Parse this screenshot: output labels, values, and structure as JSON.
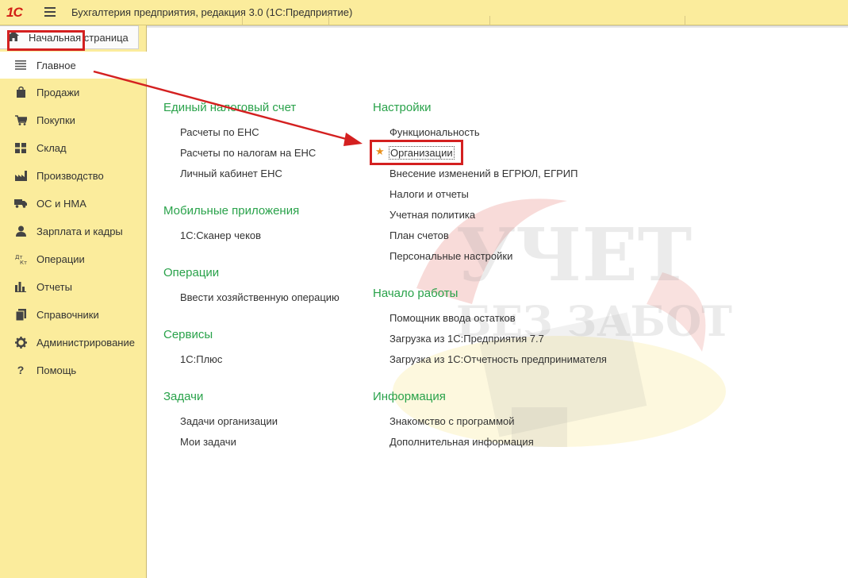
{
  "titlebar": {
    "logo": "1С",
    "app_title": "Бухгалтерия предприятия, редакция 3.0  (1С:Предприятие)"
  },
  "sidebar": {
    "home_label": "Начальная страница",
    "items": [
      {
        "label": "Главное",
        "icon": "menu-lines-icon",
        "active": true
      },
      {
        "label": "Продажи",
        "icon": "shopping-bag-icon"
      },
      {
        "label": "Покупки",
        "icon": "cart-icon"
      },
      {
        "label": "Склад",
        "icon": "warehouse-grid-icon"
      },
      {
        "label": "Производство",
        "icon": "factory-icon"
      },
      {
        "label": "ОС и НМА",
        "icon": "truck-icon"
      },
      {
        "label": "Зарплата и кадры",
        "icon": "person-icon"
      },
      {
        "label": "Операции",
        "icon": "debit-credit-icon"
      },
      {
        "label": "Отчеты",
        "icon": "bar-chart-icon"
      },
      {
        "label": "Справочники",
        "icon": "books-icon"
      },
      {
        "label": "Администрирование",
        "icon": "gear-icon"
      },
      {
        "label": "Помощь",
        "icon": "question-icon"
      }
    ]
  },
  "main": {
    "left_column": [
      {
        "title": "Единый налоговый счет",
        "links": [
          "Расчеты по ЕНС",
          "Расчеты по налогам на ЕНС",
          "Личный кабинет ЕНС"
        ]
      },
      {
        "title": "Мобильные приложения",
        "links": [
          "1С:Сканер чеков"
        ]
      },
      {
        "title": "Операции",
        "links": [
          "Ввести хозяйственную операцию"
        ]
      },
      {
        "title": "Сервисы",
        "links": [
          "1С:Плюс"
        ]
      },
      {
        "title": "Задачи",
        "links": [
          "Задачи организации",
          "Мои задачи"
        ]
      }
    ],
    "right_column": [
      {
        "title": "Настройки",
        "links": [
          "Функциональность",
          "Организации",
          "Внесение изменений в ЕГРЮЛ, ЕГРИП",
          "Налоги и отчеты",
          "Учетная политика",
          "План счетов",
          "Персональные настройки"
        ]
      },
      {
        "title": "Начало работы",
        "links": [
          "Помощник ввода остатков",
          "Загрузка из 1С:Предприятия 7.7",
          "Загрузка из 1С:Отчетность предпринимателя"
        ]
      },
      {
        "title": "Информация",
        "links": [
          "Знакомство с программой",
          "Дополнительная информация"
        ]
      }
    ],
    "favorite_star": "★"
  },
  "watermark": {
    "line1": "УЧЕТ",
    "line2": "БЕЗ ЗАБОТ"
  },
  "colors": {
    "accent_green": "#29a24a",
    "highlight_red": "#d42020",
    "sidebar_bg": "#fbec9c",
    "star": "#e98f1a"
  }
}
